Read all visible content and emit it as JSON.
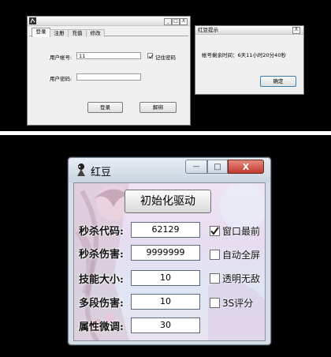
{
  "login_window": {
    "tabs": [
      "登录",
      "注册",
      "充值",
      "修改"
    ],
    "account_label": "用户帐号:",
    "account_value": "11",
    "remember_label": "记住密码",
    "remember_checked": true,
    "password_label": "用户密码:",
    "password_value": "",
    "login_button": "登录",
    "unbind_button": "解绑",
    "controls": {
      "minimize": "_",
      "maximize": "□",
      "close": "X"
    }
  },
  "alert_window": {
    "title": "红豆提示",
    "close": "X",
    "message": "帐号剩余时间：6天11小时20分40秒",
    "ok_button": "确定"
  },
  "hongdou_window": {
    "title": "红豆",
    "controls": {
      "minimize": "—",
      "maximize": "□",
      "close": "X"
    },
    "init_button": "初始化驱动",
    "fields": [
      {
        "label": "秒杀代码:",
        "value": "62129"
      },
      {
        "label": "秒杀伤害:",
        "value": "9999999"
      },
      {
        "label": "技能大小:",
        "value": "10"
      },
      {
        "label": "多段伤害:",
        "value": "10"
      },
      {
        "label": "属性微调:",
        "value": "30"
      }
    ],
    "options": [
      {
        "label": "窗口最前",
        "checked": true
      },
      {
        "label": "自动全屏",
        "checked": false
      },
      {
        "label": "透明无敌",
        "checked": false
      },
      {
        "label": "3S评分",
        "checked": false
      }
    ],
    "colors": {
      "titlebar": "#d6dee8",
      "close_button": "#c8423a"
    }
  }
}
